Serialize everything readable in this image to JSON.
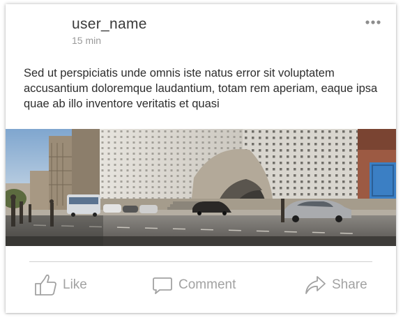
{
  "post": {
    "user_name": "user_name",
    "time": "15 min",
    "body": "Sed ut perspiciatis unde omnis iste natus error sit voluptatem accusantium doloremque laudantium, totam rem aperiam, eaque ipsa quae ab illo inventore veritatis et quasi",
    "more_icon": "more-horizontal-icon"
  },
  "actions": {
    "like_label": "Like",
    "comment_label": "Comment",
    "share_label": "Share"
  },
  "colors": {
    "username": "#3a3a3a",
    "timestamp": "#9a9a9a",
    "body_text": "#2d2d2d",
    "action_gray": "#a2a2a2",
    "divider": "#cfcfcf"
  }
}
